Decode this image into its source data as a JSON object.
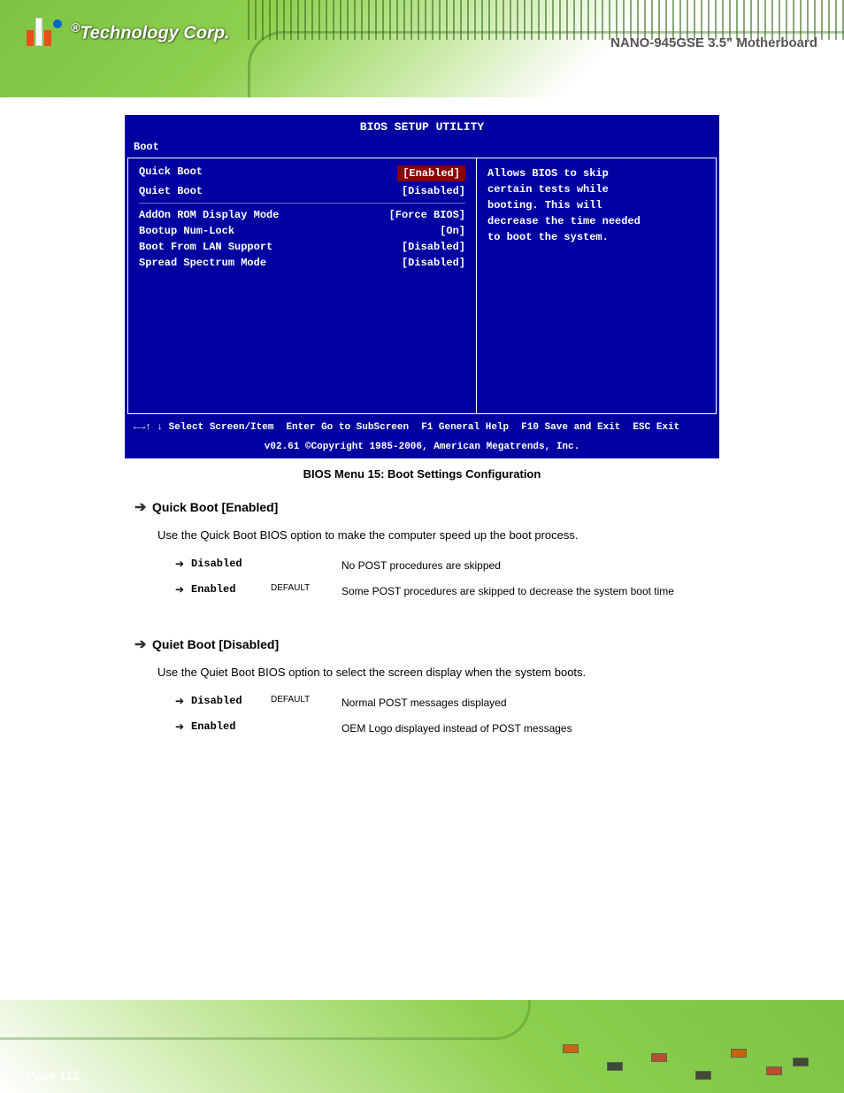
{
  "product_name": "NANO-945GSE 3.5\" Motherboard",
  "logo_text": "Technology Corp.",
  "bios": {
    "title": "BIOS SETUP UTILITY",
    "tab": "Boot",
    "rows": [
      {
        "label": "Quick Boot",
        "value": "[Enabled]",
        "selected": true
      },
      {
        "label": "Quiet Boot",
        "value": "[Disabled]",
        "selected": false
      },
      {
        "label": "AddOn ROM Display Mode",
        "value": "[Force BIOS]",
        "selected": false
      },
      {
        "label": "Bootup Num-Lock",
        "value": "[On]",
        "selected": false
      },
      {
        "label": "Boot From LAN Support",
        "value": "[Disabled]",
        "selected": false
      },
      {
        "label": "Spread Spectrum Mode",
        "value": "[Disabled]",
        "selected": false
      }
    ],
    "help": [
      "Allows BIOS to skip",
      "certain tests while",
      "booting. This will",
      "decrease the time needed",
      "to boot the system."
    ],
    "footer": [
      {
        "key": "←→↑ ↓",
        "desc": "Select Screen/Item"
      },
      {
        "key": "Enter",
        "desc": "Go to SubScreen"
      },
      {
        "key": "F1",
        "desc": "General Help"
      },
      {
        "key": "F10",
        "desc": "Save and Exit"
      },
      {
        "key": "ESC",
        "desc": "Exit"
      }
    ],
    "copyright": "v02.61 ©Copyright 1985-2006, American Megatrends, Inc."
  },
  "bios_caption": "BIOS Menu 15: Boot Settings Configuration",
  "sections": [
    {
      "heading": "Quick Boot [Enabled]",
      "body": "Use the Quick Boot BIOS option to make the computer speed up the boot process.",
      "options": [
        {
          "name": "Disabled",
          "def": "",
          "desc": "No POST procedures are skipped"
        },
        {
          "name": "Enabled",
          "def": "DEFAULT",
          "desc": "Some POST procedures are skipped to decrease the system boot time"
        }
      ]
    },
    {
      "heading": "Quiet Boot [Disabled]",
      "body": "Use the Quiet Boot BIOS option to select the screen display when the system boots.",
      "options": [
        {
          "name": "Disabled",
          "def": "DEFAULT",
          "desc": "Normal POST messages displayed"
        },
        {
          "name": "Enabled",
          "def": "",
          "desc": "OEM Logo displayed instead of POST messages"
        }
      ]
    }
  ],
  "page_number": "Page 112"
}
